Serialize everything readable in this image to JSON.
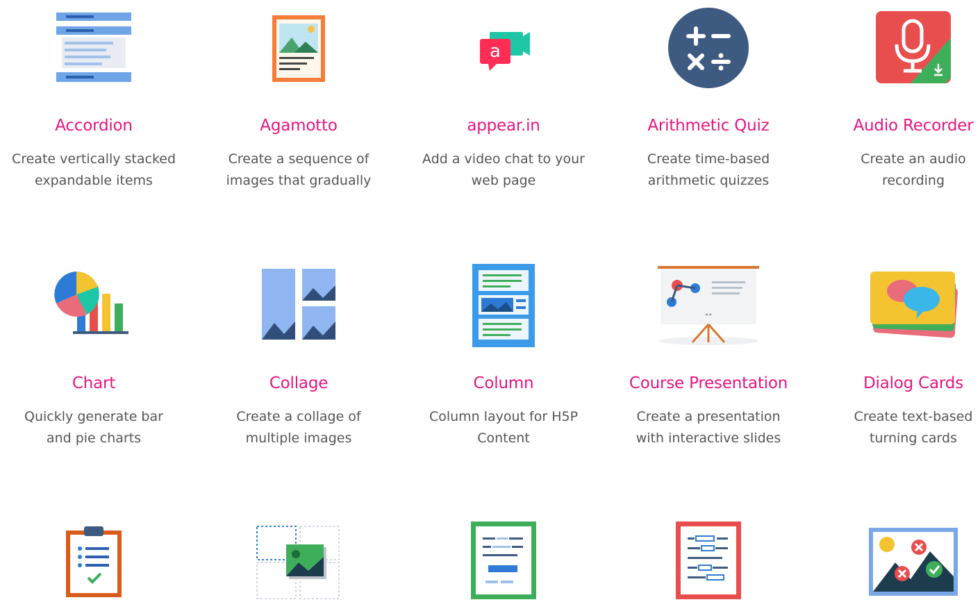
{
  "cards": [
    {
      "icon": "accordion-icon",
      "title": "Accordion",
      "desc": "Create vertically stacked\nexpandable items"
    },
    {
      "icon": "agamotto-icon",
      "title": "Agamotto",
      "desc": "Create a sequence of\nimages that gradually"
    },
    {
      "icon": "appear-in-icon",
      "title": "appear.in",
      "desc": "Add a video chat to your\nweb page"
    },
    {
      "icon": "arithmetic-quiz-icon",
      "title": "Arithmetic Quiz",
      "desc": "Create time-based\narithmetic quizzes"
    },
    {
      "icon": "audio-recorder-icon",
      "title": "Audio Recorder",
      "desc": "Create an audio\nrecording"
    },
    {
      "icon": "chart-icon",
      "title": "Chart",
      "desc": "Quickly generate bar\nand pie charts"
    },
    {
      "icon": "collage-icon",
      "title": "Collage",
      "desc": "Create a collage of\nmultiple images"
    },
    {
      "icon": "column-icon",
      "title": "Column",
      "desc": "Column layout for H5P\nContent"
    },
    {
      "icon": "course-presentation-icon",
      "title": "Course Presentation",
      "desc": "Create a presentation\nwith interactive slides"
    },
    {
      "icon": "dialog-cards-icon",
      "title": "Dialog Cards",
      "desc": "Create text-based\nturning cards"
    },
    {
      "icon": "documentation-tool-icon",
      "title": "",
      "desc": ""
    },
    {
      "icon": "drag-and-drop-icon",
      "title": "",
      "desc": ""
    },
    {
      "icon": "drag-the-words-icon",
      "title": "",
      "desc": ""
    },
    {
      "icon": "fill-in-the-blanks-icon",
      "title": "",
      "desc": ""
    },
    {
      "icon": "find-hotspot-icon",
      "title": "",
      "desc": ""
    }
  ],
  "colors": {
    "title": "#e6157f",
    "desc": "#555555"
  }
}
